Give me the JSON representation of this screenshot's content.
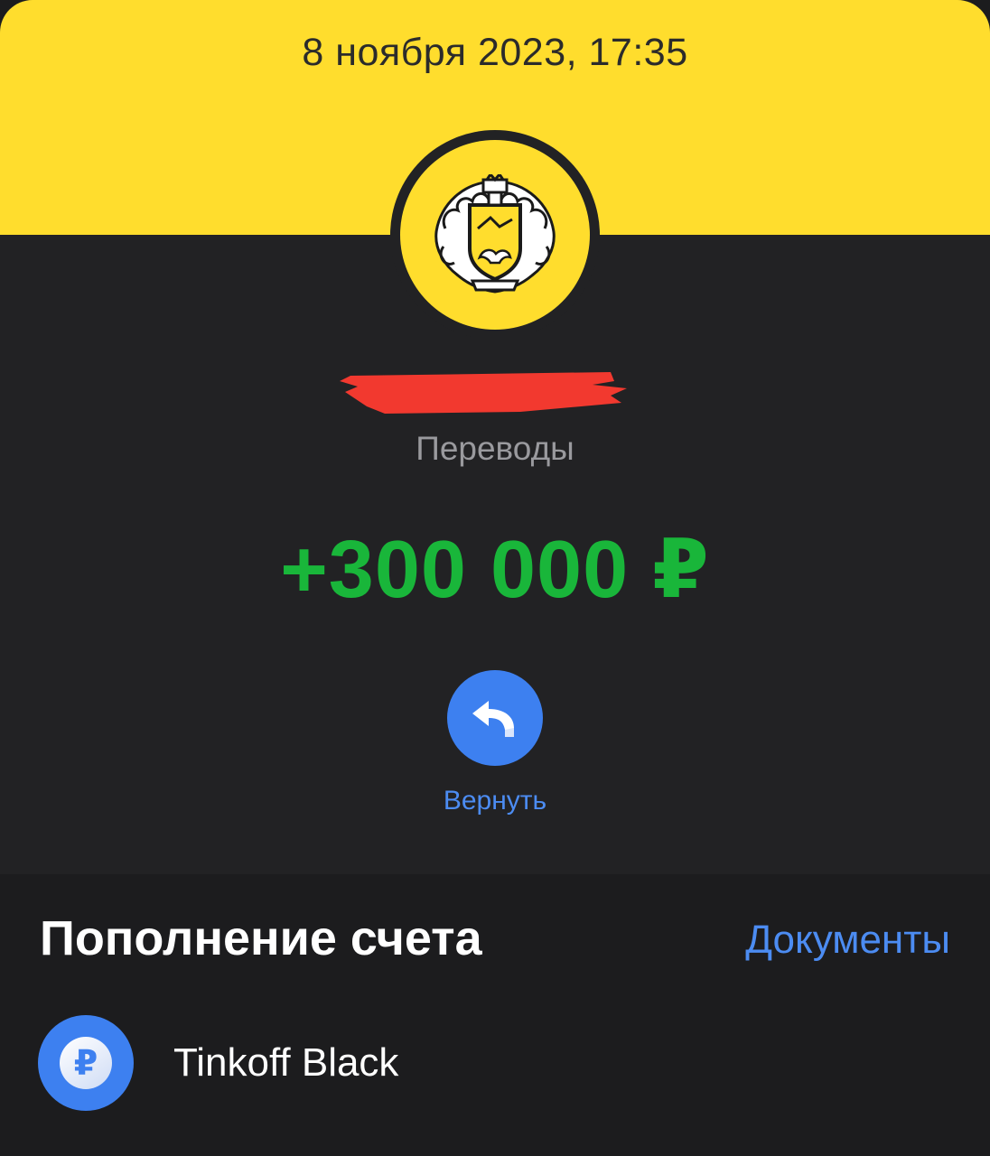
{
  "header": {
    "datetime": "8 ноября 2023, 17:35"
  },
  "transaction": {
    "category": "Переводы",
    "amount": "+300 000 ₽",
    "return_label": "Вернуть"
  },
  "colors": {
    "brand_yellow": "#ffdd2d",
    "amount_green": "#19b63a",
    "accent_blue": "#3d80f0",
    "redaction_red": "#f2392f"
  },
  "section": {
    "title": "Пополнение счета",
    "documents_link": "Документы"
  },
  "account": {
    "currency_symbol": "₽",
    "name": "Tinkoff Black"
  }
}
